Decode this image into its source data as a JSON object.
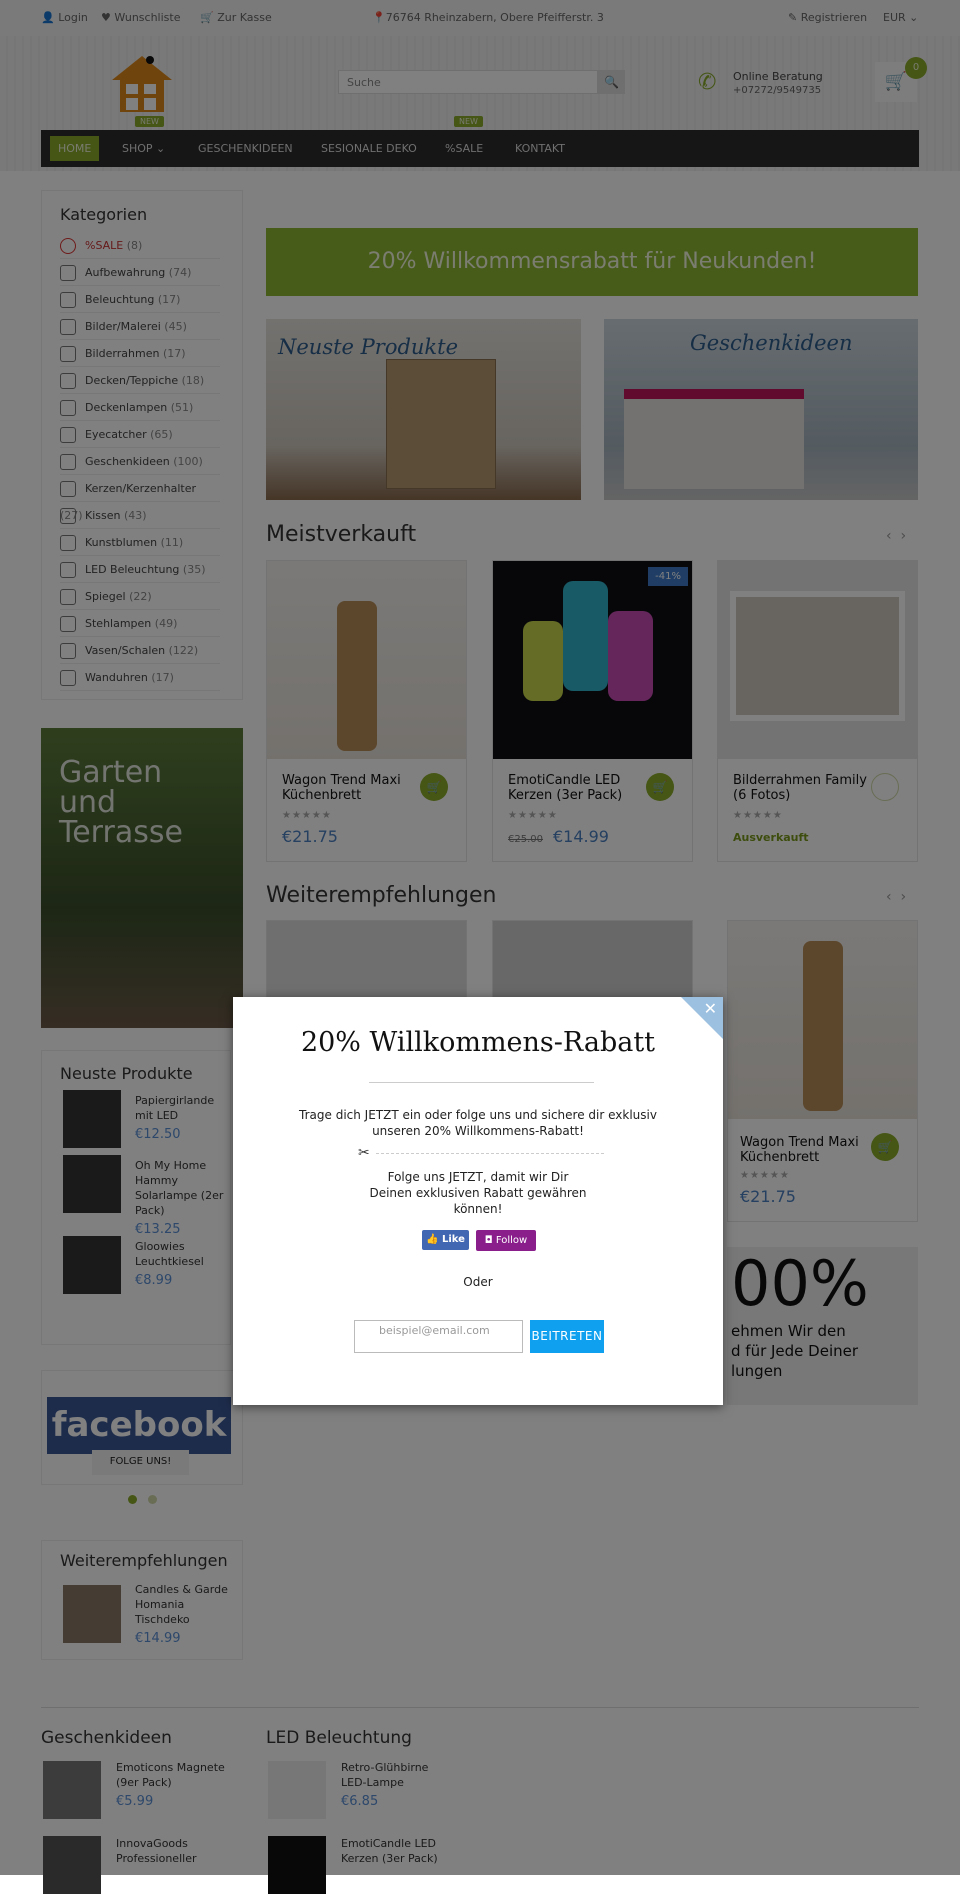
{
  "topbar": {
    "login": "Login",
    "wishlist": "Wunschliste",
    "checkout": "Zur Kasse",
    "address": "76764 Rheinzabern, Obere Pfeifferstr. 3",
    "register": "Registrieren",
    "currency": "EUR"
  },
  "header": {
    "search_placeholder": "Suche",
    "consult_title": "Online Beratung",
    "phone": "+07272/9549735",
    "cart_count": "0"
  },
  "nav": {
    "items": [
      "HOME",
      "SHOP",
      "GESCHENKIDEEN",
      "SESIONALE DEKO",
      "%SALE",
      "KONTAKT"
    ],
    "new_badge": "NEW"
  },
  "sidebar": {
    "categories_title": "Kategorien",
    "categories": [
      {
        "label": "%SALE",
        "count": "(8)"
      },
      {
        "label": "Aufbewahrung",
        "count": "(74)"
      },
      {
        "label": "Beleuchtung",
        "count": "(17)"
      },
      {
        "label": "Bilder/Malerei",
        "count": "(45)"
      },
      {
        "label": "Bilderrahmen",
        "count": "(17)"
      },
      {
        "label": "Decken/Teppiche",
        "count": "(18)"
      },
      {
        "label": "Deckenlampen",
        "count": "(51)"
      },
      {
        "label": "Eyecatcher",
        "count": "(65)"
      },
      {
        "label": "Geschenkideen",
        "count": "(100)"
      },
      {
        "label": "Kerzen/Kerzenhalter",
        "count": "(27)"
      },
      {
        "label": "Kissen",
        "count": "(43)"
      },
      {
        "label": "Kunstblumen",
        "count": "(11)"
      },
      {
        "label": "LED Beleuchtung",
        "count": "(35)"
      },
      {
        "label": "Spiegel",
        "count": "(22)"
      },
      {
        "label": "Stehlampen",
        "count": "(49)"
      },
      {
        "label": "Vasen/Schalen",
        "count": "(122)"
      },
      {
        "label": "Wanduhren",
        "count": "(17)"
      }
    ],
    "garden_banner": "Garten und Terrasse",
    "newest_title": "Neuste Produkte",
    "newest": [
      {
        "name": "Papiergirlande mit LED",
        "price": "€12.50"
      },
      {
        "name": "Oh My Home Hammy Solarlampe (2er Pack)",
        "price": "€13.25"
      },
      {
        "name": "Gloowies Leuchtkiesel",
        "price": "€8.99"
      }
    ],
    "facebook_logo": "facebook",
    "facebook_follow": "FOLGE UNS!",
    "recommend_title": "Weiterempfehlungen",
    "recommend": [
      {
        "name": "Candles & Garde Homania Tischdeko",
        "price": "€14.99"
      }
    ]
  },
  "main": {
    "banner": "20% Willkommensrabatt für Neukunden!",
    "promo_left": "Neuste Produkte",
    "promo_right": "Geschenkideen",
    "bestsellers_title": "Meistverkauft",
    "bestsellers": [
      {
        "name": "Wagon Trend Maxi Küchenbrett",
        "price": "€21.75"
      },
      {
        "name": "EmotiCandle LED Kerzen (3er Pack)",
        "old_price": "€25.00",
        "price": "€14.99",
        "badge": "-41%"
      },
      {
        "name": "Bilderrahmen Family (6 Fotos)",
        "status": "Ausverkauft"
      }
    ],
    "recommend_title": "Weiterempfehlungen",
    "recommend_card": {
      "name": "Wagon Trend Maxi Küchenbrett",
      "price": "€21.75"
    },
    "promo_big": "00%",
    "promo_text": "ehmen Wir den\nd für Jede Deiner\nlungen"
  },
  "footer": {
    "col1_title": "Geschenkideen",
    "col1": [
      {
        "name": "Emoticons Magnete (9er Pack)",
        "price": "€5.99"
      },
      {
        "name": "InnovaGoods Professioneller"
      }
    ],
    "col2_title": "LED Beleuchtung",
    "col2": [
      {
        "name": "Retro-Glühbirne LED-Lampe",
        "price": "€6.85"
      },
      {
        "name": "EmotiCandle LED Kerzen (3er Pack)"
      }
    ]
  },
  "modal": {
    "title": "20% Willkommens-Rabatt",
    "text1": "Trage dich JETZT ein oder folge uns und sichere dir exklusiv unseren 20% Willkommens-Rabatt!",
    "text2": "Folge uns JETZT, damit wir Dir Deinen exklusiven Rabatt gewähren können!",
    "like": "Like",
    "follow": "Follow",
    "or": "Oder",
    "email_placeholder": "beispiel@email.com",
    "join": "BEITRETEN"
  },
  "colors": {
    "accent": "#8aab2a",
    "price": "#4a7fc1",
    "modal_button": "#0fa0f0",
    "facebook": "#3b5998",
    "instagram": "#8a1f8c"
  }
}
